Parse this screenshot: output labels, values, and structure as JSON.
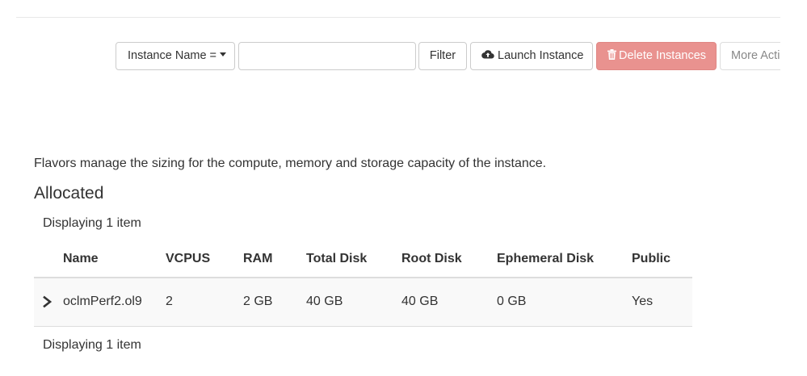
{
  "toolbar": {
    "filter_field_label": "Instance Name =",
    "search_value": "",
    "filter_label": "Filter",
    "launch_label": "Launch Instance",
    "delete_label": "Delete Instances",
    "more_label": "More Actions"
  },
  "flavor": {
    "help_text": "Flavors manage the sizing for the compute, memory and storage capacity of the instance.",
    "section_title": "Allocated",
    "count_top": "Displaying 1 item",
    "count_bottom": "Displaying 1 item",
    "columns": [
      "Name",
      "VCPUS",
      "RAM",
      "Total Disk",
      "Root Disk",
      "Ephemeral Disk",
      "Public"
    ],
    "rows": [
      {
        "name": "oclmPerf2.ol9",
        "vcpus": "2",
        "ram": "2 GB",
        "total_disk": "40 GB",
        "root_disk": "40 GB",
        "ephemeral_disk": "0 GB",
        "public": "Yes"
      }
    ]
  },
  "colors": {
    "delete_button": "#e9928f",
    "text": "#333333",
    "row_background": "#f9f9f9"
  },
  "icons": {
    "launch": "cloud-upload-icon",
    "delete": "trash-icon",
    "expand": "chevron-right-icon",
    "caret": "caret-down-icon"
  }
}
